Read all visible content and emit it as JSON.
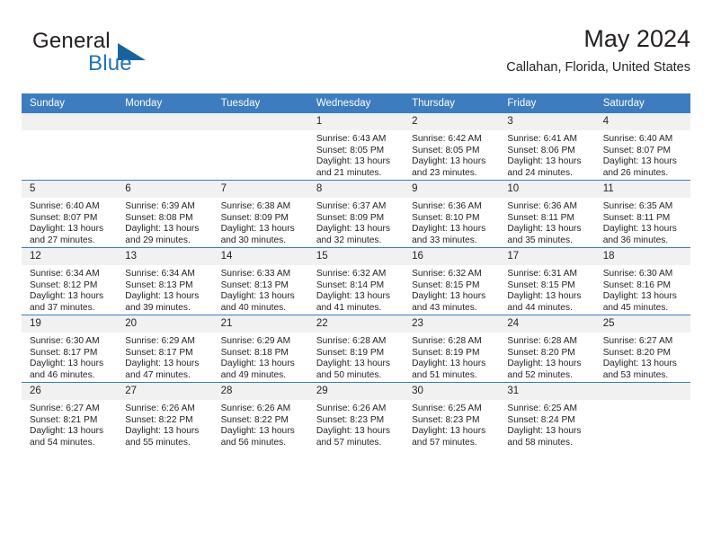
{
  "brand": {
    "name_part1": "General",
    "name_part2": "Blue",
    "triangle_color": "#16639f",
    "blue_color": "#1f72b8"
  },
  "header": {
    "title": "May 2024",
    "subtitle": "Callahan, Florida, United States"
  },
  "theme": {
    "header_bg": "#3c7cbf",
    "daynum_bg": "#f1f1f1",
    "text": "#231f20",
    "row_border": "#3c7cbf"
  },
  "weekday_headers": [
    "Sunday",
    "Monday",
    "Tuesday",
    "Wednesday",
    "Thursday",
    "Friday",
    "Saturday"
  ],
  "labels": {
    "sunrise": "Sunrise:",
    "sunset": "Sunset:",
    "daylight": "Daylight:"
  },
  "weeks": [
    [
      {
        "day": "",
        "sunrise": "",
        "sunset": "",
        "daylight": "",
        "empty": true
      },
      {
        "day": "",
        "sunrise": "",
        "sunset": "",
        "daylight": "",
        "empty": true
      },
      {
        "day": "",
        "sunrise": "",
        "sunset": "",
        "daylight": "",
        "empty": true
      },
      {
        "day": "1",
        "sunrise": "Sunrise: 6:43 AM",
        "sunset": "Sunset: 8:05 PM",
        "daylight": "Daylight: 13 hours and 21 minutes."
      },
      {
        "day": "2",
        "sunrise": "Sunrise: 6:42 AM",
        "sunset": "Sunset: 8:05 PM",
        "daylight": "Daylight: 13 hours and 23 minutes."
      },
      {
        "day": "3",
        "sunrise": "Sunrise: 6:41 AM",
        "sunset": "Sunset: 8:06 PM",
        "daylight": "Daylight: 13 hours and 24 minutes."
      },
      {
        "day": "4",
        "sunrise": "Sunrise: 6:40 AM",
        "sunset": "Sunset: 8:07 PM",
        "daylight": "Daylight: 13 hours and 26 minutes."
      }
    ],
    [
      {
        "day": "5",
        "sunrise": "Sunrise: 6:40 AM",
        "sunset": "Sunset: 8:07 PM",
        "daylight": "Daylight: 13 hours and 27 minutes."
      },
      {
        "day": "6",
        "sunrise": "Sunrise: 6:39 AM",
        "sunset": "Sunset: 8:08 PM",
        "daylight": "Daylight: 13 hours and 29 minutes."
      },
      {
        "day": "7",
        "sunrise": "Sunrise: 6:38 AM",
        "sunset": "Sunset: 8:09 PM",
        "daylight": "Daylight: 13 hours and 30 minutes."
      },
      {
        "day": "8",
        "sunrise": "Sunrise: 6:37 AM",
        "sunset": "Sunset: 8:09 PM",
        "daylight": "Daylight: 13 hours and 32 minutes."
      },
      {
        "day": "9",
        "sunrise": "Sunrise: 6:36 AM",
        "sunset": "Sunset: 8:10 PM",
        "daylight": "Daylight: 13 hours and 33 minutes."
      },
      {
        "day": "10",
        "sunrise": "Sunrise: 6:36 AM",
        "sunset": "Sunset: 8:11 PM",
        "daylight": "Daylight: 13 hours and 35 minutes."
      },
      {
        "day": "11",
        "sunrise": "Sunrise: 6:35 AM",
        "sunset": "Sunset: 8:11 PM",
        "daylight": "Daylight: 13 hours and 36 minutes."
      }
    ],
    [
      {
        "day": "12",
        "sunrise": "Sunrise: 6:34 AM",
        "sunset": "Sunset: 8:12 PM",
        "daylight": "Daylight: 13 hours and 37 minutes."
      },
      {
        "day": "13",
        "sunrise": "Sunrise: 6:34 AM",
        "sunset": "Sunset: 8:13 PM",
        "daylight": "Daylight: 13 hours and 39 minutes."
      },
      {
        "day": "14",
        "sunrise": "Sunrise: 6:33 AM",
        "sunset": "Sunset: 8:13 PM",
        "daylight": "Daylight: 13 hours and 40 minutes."
      },
      {
        "day": "15",
        "sunrise": "Sunrise: 6:32 AM",
        "sunset": "Sunset: 8:14 PM",
        "daylight": "Daylight: 13 hours and 41 minutes."
      },
      {
        "day": "16",
        "sunrise": "Sunrise: 6:32 AM",
        "sunset": "Sunset: 8:15 PM",
        "daylight": "Daylight: 13 hours and 43 minutes."
      },
      {
        "day": "17",
        "sunrise": "Sunrise: 6:31 AM",
        "sunset": "Sunset: 8:15 PM",
        "daylight": "Daylight: 13 hours and 44 minutes."
      },
      {
        "day": "18",
        "sunrise": "Sunrise: 6:30 AM",
        "sunset": "Sunset: 8:16 PM",
        "daylight": "Daylight: 13 hours and 45 minutes."
      }
    ],
    [
      {
        "day": "19",
        "sunrise": "Sunrise: 6:30 AM",
        "sunset": "Sunset: 8:17 PM",
        "daylight": "Daylight: 13 hours and 46 minutes."
      },
      {
        "day": "20",
        "sunrise": "Sunrise: 6:29 AM",
        "sunset": "Sunset: 8:17 PM",
        "daylight": "Daylight: 13 hours and 47 minutes."
      },
      {
        "day": "21",
        "sunrise": "Sunrise: 6:29 AM",
        "sunset": "Sunset: 8:18 PM",
        "daylight": "Daylight: 13 hours and 49 minutes."
      },
      {
        "day": "22",
        "sunrise": "Sunrise: 6:28 AM",
        "sunset": "Sunset: 8:19 PM",
        "daylight": "Daylight: 13 hours and 50 minutes."
      },
      {
        "day": "23",
        "sunrise": "Sunrise: 6:28 AM",
        "sunset": "Sunset: 8:19 PM",
        "daylight": "Daylight: 13 hours and 51 minutes."
      },
      {
        "day": "24",
        "sunrise": "Sunrise: 6:28 AM",
        "sunset": "Sunset: 8:20 PM",
        "daylight": "Daylight: 13 hours and 52 minutes."
      },
      {
        "day": "25",
        "sunrise": "Sunrise: 6:27 AM",
        "sunset": "Sunset: 8:20 PM",
        "daylight": "Daylight: 13 hours and 53 minutes."
      }
    ],
    [
      {
        "day": "26",
        "sunrise": "Sunrise: 6:27 AM",
        "sunset": "Sunset: 8:21 PM",
        "daylight": "Daylight: 13 hours and 54 minutes."
      },
      {
        "day": "27",
        "sunrise": "Sunrise: 6:26 AM",
        "sunset": "Sunset: 8:22 PM",
        "daylight": "Daylight: 13 hours and 55 minutes."
      },
      {
        "day": "28",
        "sunrise": "Sunrise: 6:26 AM",
        "sunset": "Sunset: 8:22 PM",
        "daylight": "Daylight: 13 hours and 56 minutes."
      },
      {
        "day": "29",
        "sunrise": "Sunrise: 6:26 AM",
        "sunset": "Sunset: 8:23 PM",
        "daylight": "Daylight: 13 hours and 57 minutes."
      },
      {
        "day": "30",
        "sunrise": "Sunrise: 6:25 AM",
        "sunset": "Sunset: 8:23 PM",
        "daylight": "Daylight: 13 hours and 57 minutes."
      },
      {
        "day": "31",
        "sunrise": "Sunrise: 6:25 AM",
        "sunset": "Sunset: 8:24 PM",
        "daylight": "Daylight: 13 hours and 58 minutes."
      },
      {
        "day": "",
        "sunrise": "",
        "sunset": "",
        "daylight": "",
        "empty": true
      }
    ]
  ]
}
